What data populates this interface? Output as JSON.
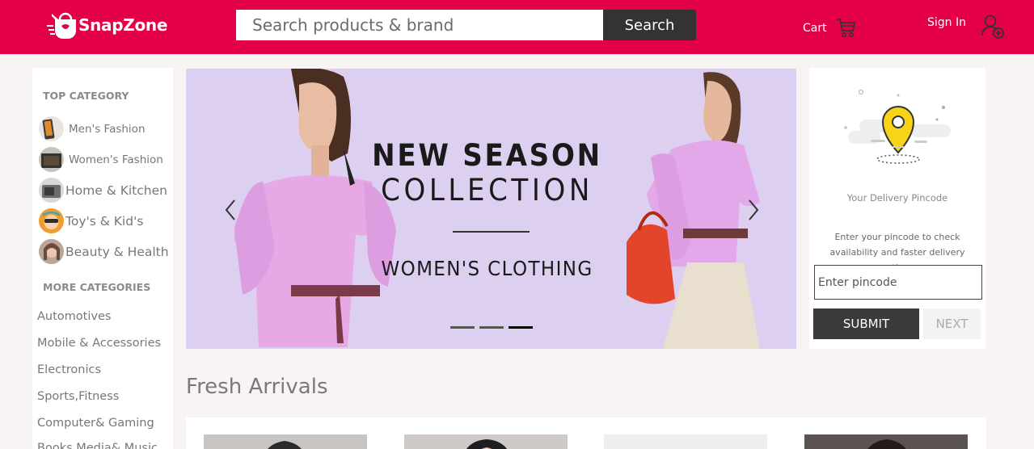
{
  "header": {
    "logo_text": "SnapZone",
    "search": {
      "placeholder": "Search products & brand",
      "button_label": "Search"
    },
    "cart_label": "Cart",
    "signin_label": "Sign In",
    "colors": {
      "brand": "#e40046",
      "dark": "#333333"
    }
  },
  "sidebar": {
    "top_heading": "TOP CATEGORY",
    "top_items": [
      {
        "label": "Men's Fashion",
        "icon": "mens-fashion-thumb"
      },
      {
        "label": "Women's Fashion",
        "icon": "womens-fashion-thumb"
      },
      {
        "label": "Home & Kitchen",
        "icon": "home-kitchen-thumb"
      },
      {
        "label": "Toy's & Kid's",
        "icon": "toys-kids-thumb"
      },
      {
        "label": "Beauty & Health",
        "icon": "beauty-health-thumb"
      }
    ],
    "more_heading": "MORE CATEGORIES",
    "more_items": [
      {
        "label": "Automotives"
      },
      {
        "label": "Mobile & Accessories"
      },
      {
        "label": "Electronics"
      },
      {
        "label": "Sports,Fitness"
      },
      {
        "label": "Computer& Gaming"
      },
      {
        "label": "Books,Media& Music"
      }
    ]
  },
  "banner": {
    "line1": "NEW SEASON",
    "line2": "COLLECTION",
    "line3": "WOMEN'S CLOTHING",
    "slide_count": 3,
    "active_slide": 3
  },
  "pincode": {
    "title": "Your Delivery Pincode",
    "description": "Enter your pincode to check availability and faster delivery options",
    "input_placeholder": "Enter pincode",
    "submit_label": "SUBMIT",
    "next_label": "NEXT"
  },
  "fresh": {
    "title": "Fresh Arrivals"
  }
}
